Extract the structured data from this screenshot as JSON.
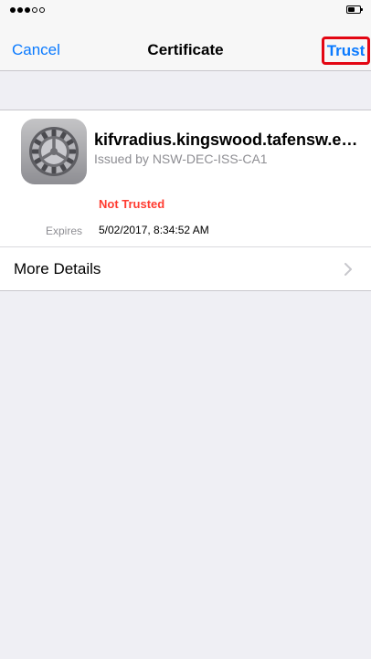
{
  "status_bar": {
    "signal_bars_filled": 3,
    "signal_bars_total": 5,
    "battery_level": 0.5
  },
  "nav": {
    "cancel_label": "Cancel",
    "title": "Certificate",
    "trust_label": "Trust"
  },
  "certificate": {
    "icon": "gear-icon",
    "name": "kifvradius.kingswood.tafensw.e…",
    "issuer": "Issued by NSW-DEC-ISS-CA1",
    "trust_status": "Not Trusted",
    "expires_label": "Expires",
    "expires_value": "5/02/2017, 8:34:52 AM"
  },
  "more_details": {
    "label": "More Details",
    "chevron": "chevron-right-icon"
  },
  "colors": {
    "accent": "#0a7aff",
    "not_trusted": "#ff3b30",
    "highlight_box": "#e30613",
    "background": "#efeff4"
  }
}
